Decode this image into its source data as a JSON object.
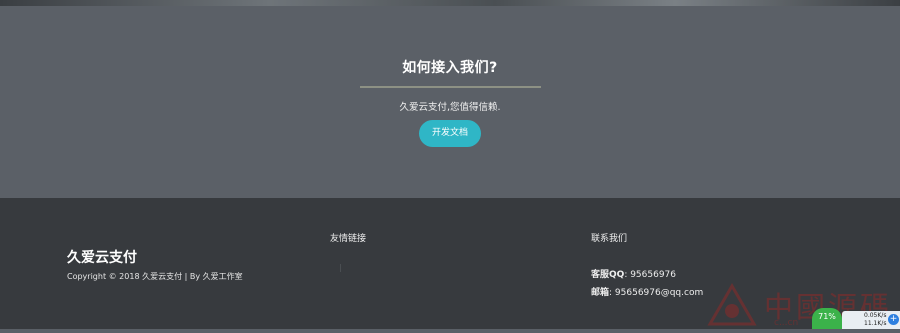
{
  "cta": {
    "title": "如何接入我们?",
    "description": "久爱云支付,您值得信赖.",
    "button_label": "开发文档"
  },
  "footer": {
    "brand": "久爱云支付",
    "copyright": "Copyright © 2018 久爱云支付 | By 久爱工作室",
    "links_heading": "友情链接",
    "contact_heading": "联系我们",
    "qq_label": "客服QQ",
    "qq_value": ": 95656976",
    "email_label": "邮箱",
    "email_value": ": 95656976@qq.com"
  },
  "speed_widget": {
    "percent": "71%",
    "upload": "0.05K/s",
    "download": "11.1K/s",
    "plus_icon": "+"
  },
  "watermark": {
    "text": "中國源碼",
    "domain": "c...cn"
  },
  "colors": {
    "cta_bg": "#5b6067",
    "footer_bg": "#373a3e",
    "button": "#2fb6c6",
    "gauge": "#3bb24a"
  }
}
